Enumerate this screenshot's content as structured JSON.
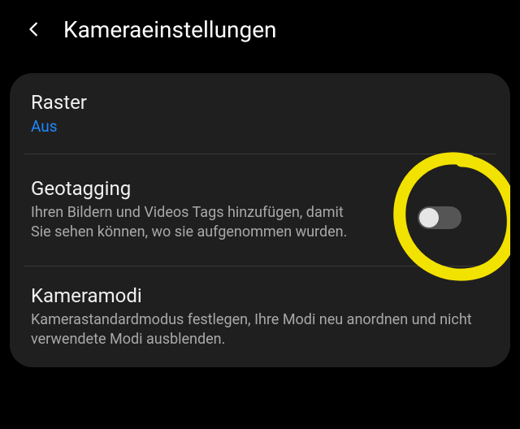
{
  "header": {
    "title": "Kameraeinstellungen"
  },
  "items": {
    "grid": {
      "title": "Raster",
      "value": "Aus"
    },
    "geotag": {
      "title": "Geotagging",
      "description": "Ihren Bildern und Videos Tags hinzufügen, damit Sie sehen können, wo sie aufgenommen wurden.",
      "toggle_on": false
    },
    "modes": {
      "title": "Kameramodi",
      "description": "Kamerastandardmodus festlegen, Ihre Modi neu anordnen und nicht verwendete Modi ausblenden."
    }
  },
  "annotation": {
    "color": "#f2e200"
  }
}
